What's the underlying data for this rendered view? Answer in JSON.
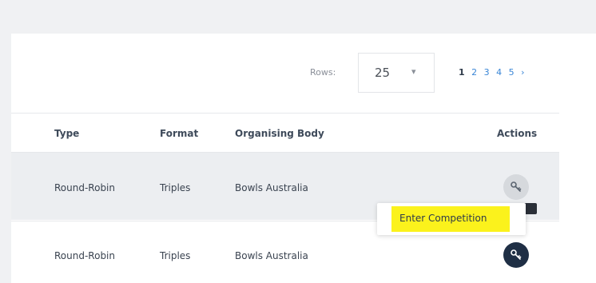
{
  "toolbar": {
    "rows_label": "Rows:",
    "rows_value": "25",
    "pagination": {
      "pages": [
        "1",
        "2",
        "3",
        "4",
        "5"
      ],
      "current": "1",
      "next": "›"
    }
  },
  "table": {
    "columns": [
      "Type",
      "Format",
      "Organising Body",
      "Actions"
    ],
    "rows": [
      {
        "type": "Round-Robin",
        "format": "Triples",
        "body": "Bowls Australia"
      },
      {
        "type": "Round-Robin",
        "format": "Triples",
        "body": "Bowls Australia"
      }
    ]
  },
  "tooltip": {
    "text": "Enter Competition"
  },
  "colors": {
    "highlight": "#fbf21c",
    "link": "#3a86d6",
    "dark_button": "#1f2f45"
  },
  "icons": {
    "action": "key-icon"
  }
}
